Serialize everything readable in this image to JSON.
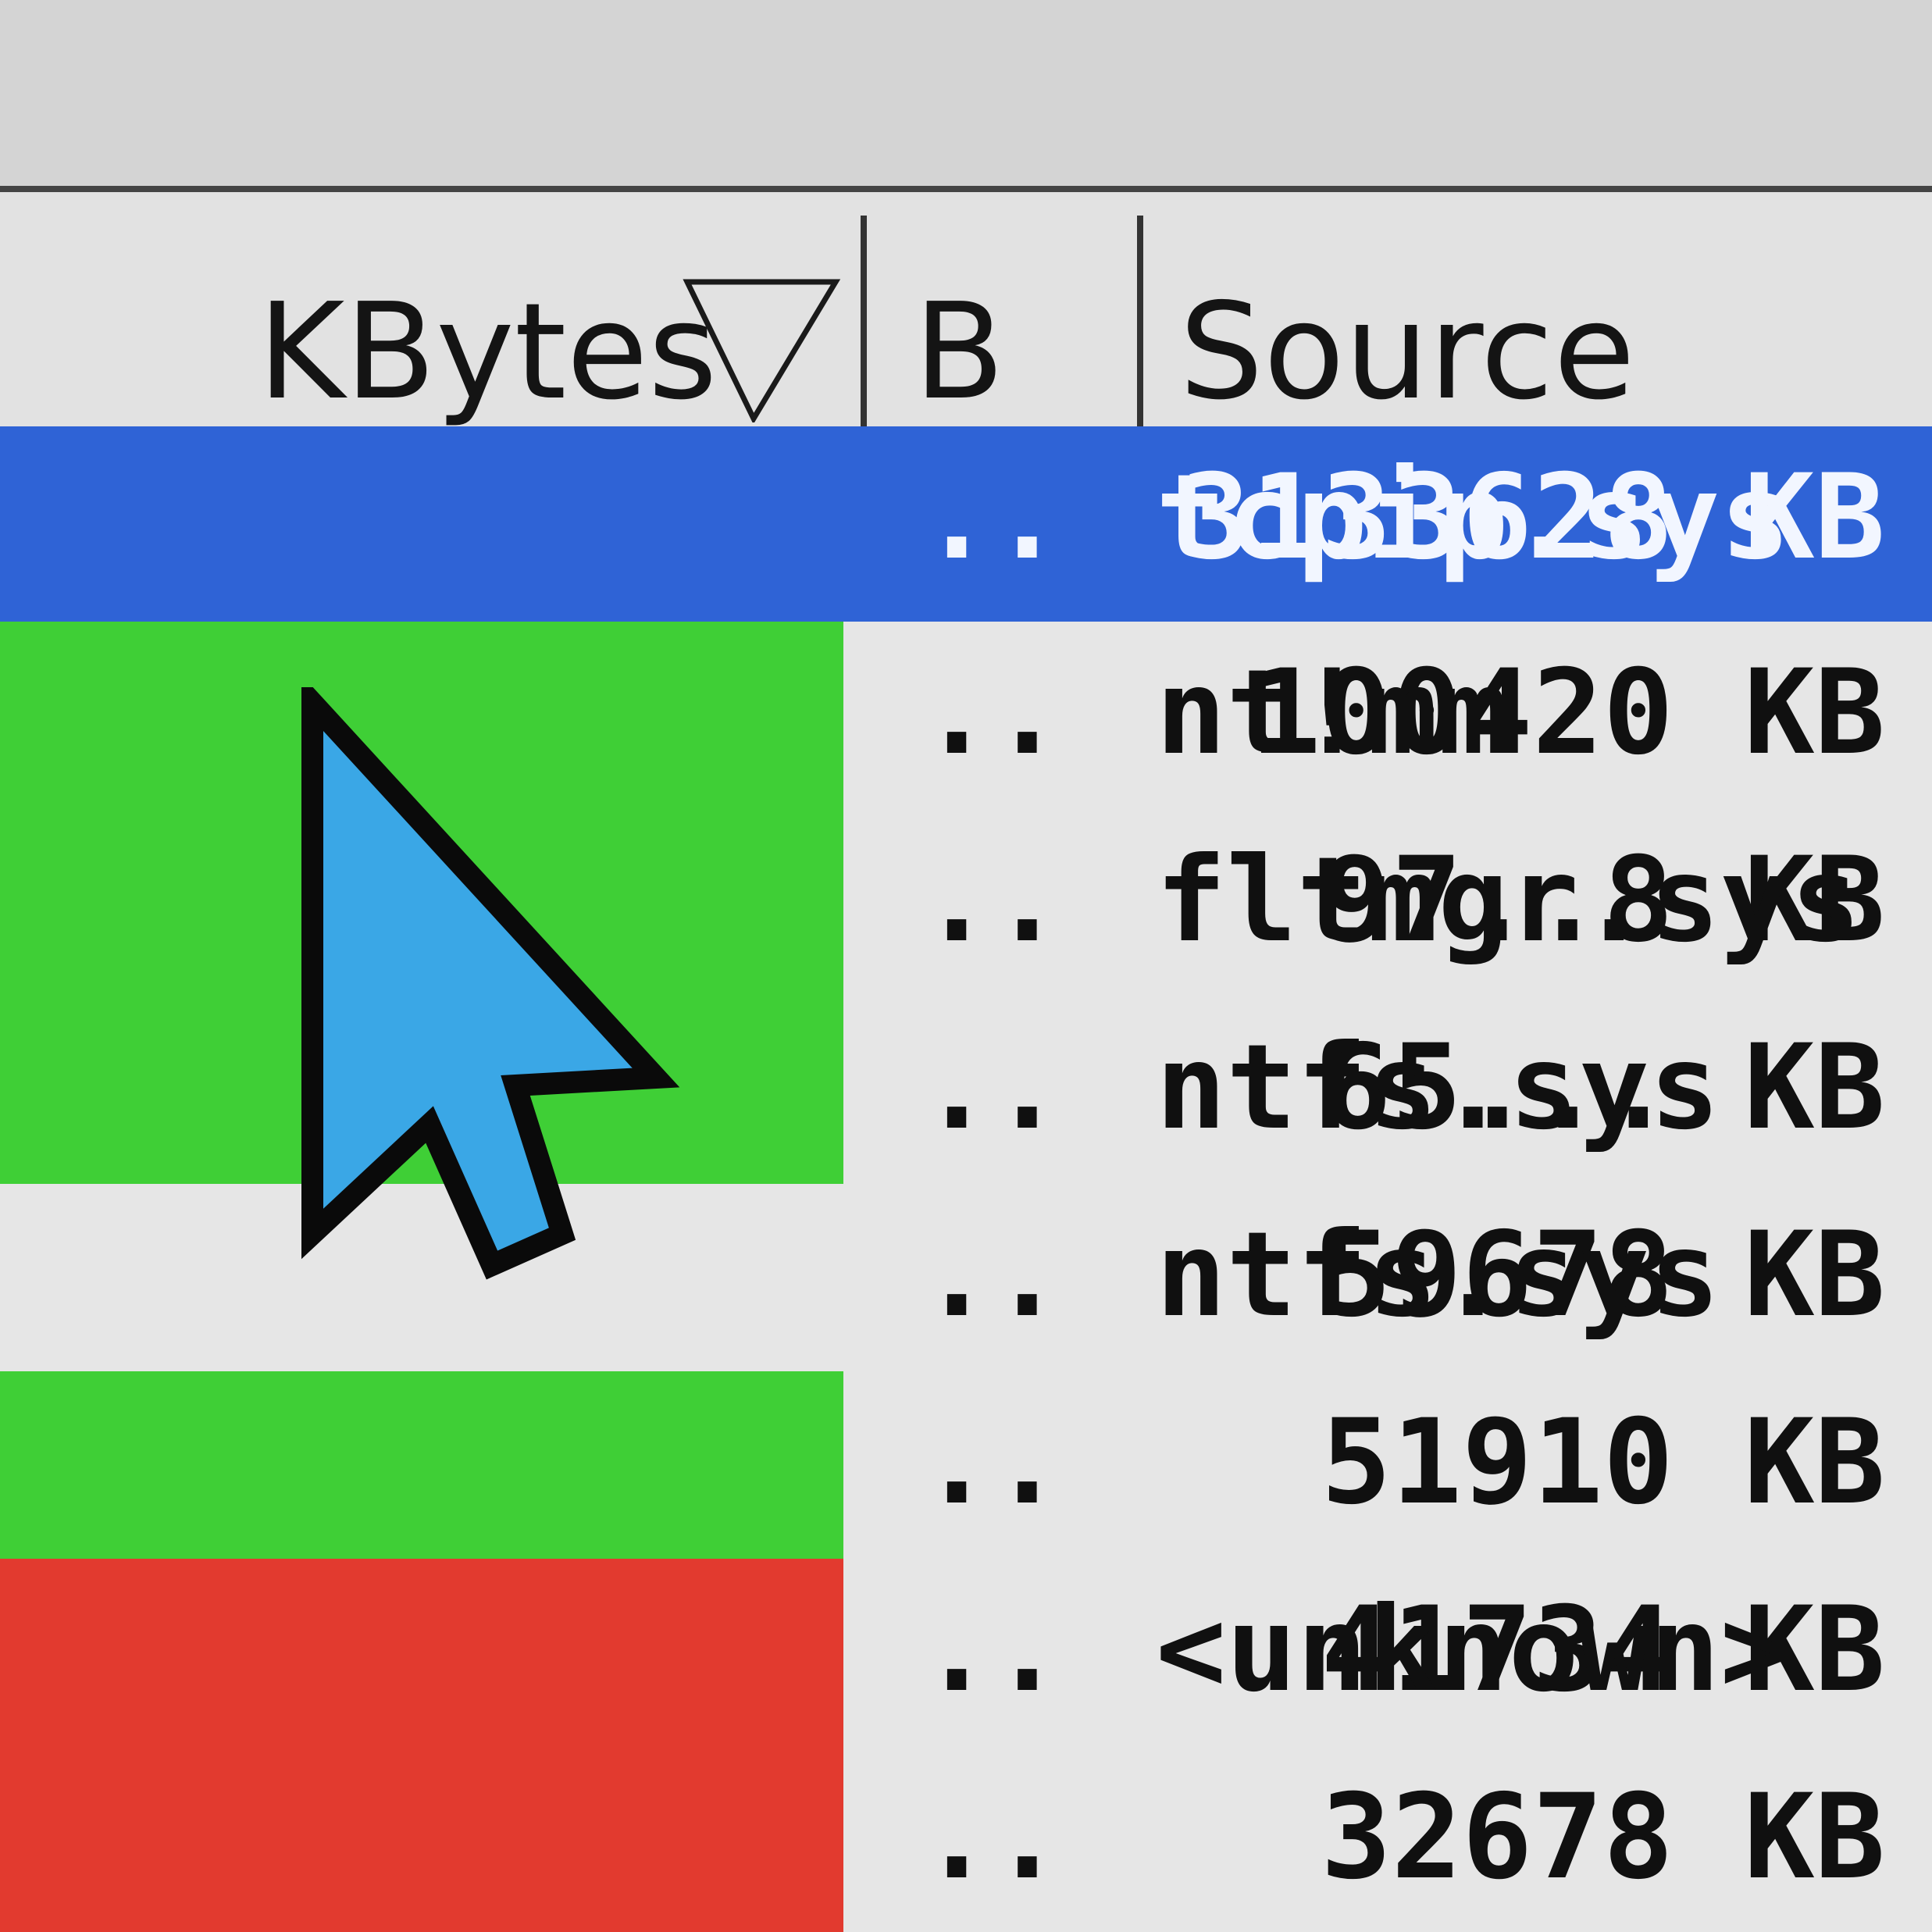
{
  "columns": {
    "kbytes": "KBytes",
    "b": "B ...",
    "source": "Source"
  },
  "sort": {
    "column": "kbytes",
    "direction": "descending",
    "icon": "sort-down-triangle-icon"
  },
  "rows": [
    {
      "kbytes": "3133628 KB",
      "b": "..",
      "source": "tcpip.sys",
      "highlight": "selected",
      "color": "#2f63d6"
    },
    {
      "kbytes": "100420 KB",
      "b": "..",
      "source": "nt!mm",
      "highlight": "green",
      "color": "#3fcf36"
    },
    {
      "kbytes": "97..8 KB",
      "b": "..",
      "source": "fltmgr.sys",
      "highlight": "green",
      "color": "#3fcf36"
    },
    {
      "kbytes": "65... KB",
      "b": "..",
      "source": "ntfs.sys",
      "highlight": "green",
      "color": "#3fcf36"
    },
    {
      "kbytes": "59678 KB",
      "b": "..",
      "source": "ntfs.sys",
      "highlight": "none",
      "color": "#e6e6e6"
    },
    {
      "kbytes": "51910 KB",
      "b": "..",
      "source": "",
      "highlight": "green",
      "color": "#3fcf36"
    },
    {
      "kbytes": "41734 KB",
      "b": "..",
      "source": "<unknown>",
      "highlight": "red",
      "color": "#e23a2f"
    },
    {
      "kbytes": "32678 KB",
      "b": "..",
      "source": "",
      "highlight": "red",
      "color": "#e23a2f"
    }
  ],
  "cursor": {
    "icon": "mouse-pointer-icon",
    "fill": "#3aa7e6",
    "outline": "#0a0a0a"
  }
}
